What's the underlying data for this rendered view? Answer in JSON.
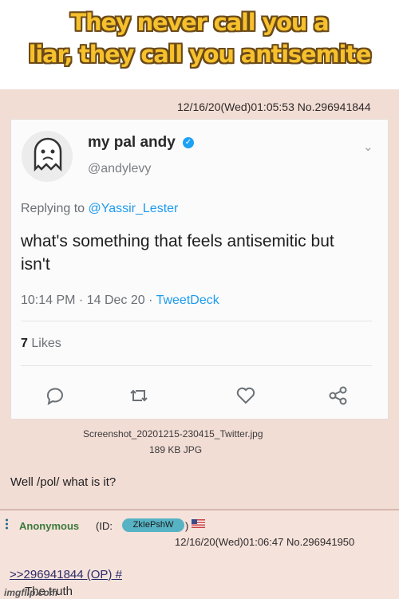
{
  "caption": {
    "line1": "They never call you a",
    "line2": "liar, they call you antisemite"
  },
  "post1": {
    "meta": "12/16/20(Wed)01:05:53 No.296941844",
    "file_name": "Screenshot_20201215-230415_Twitter.jpg",
    "file_size": "189 KB JPG",
    "comment": "Well /pol/ what is it?"
  },
  "tweet": {
    "name": "my pal andy",
    "verified_icon": "✓",
    "handle": "@andylevy",
    "replying_prefix": "Replying to",
    "replying_to": "@Yassir_Lester",
    "text": "what's something that feels antisemitic but isn't",
    "time": "10:14 PM · 14 Dec 20 ·",
    "source": "TweetDeck",
    "likes_count": "7",
    "likes_label": "Likes",
    "icons": [
      "reply-icon",
      "retweet-icon",
      "like-icon",
      "share-icon"
    ]
  },
  "post2": {
    "name": "Anonymous",
    "id_prefix": "(ID:",
    "id_value": "ZkIePshW",
    "id_suffix": ")",
    "meta": "12/16/20(Wed)01:06:47 No.296941950",
    "quote": ">>296941844 (OP) #",
    "text": "The truth"
  },
  "watermark": "imgflip.com",
  "colors": {
    "caption": "#f6c12c",
    "post_bg": "#f2ddd5",
    "name_green": "#3b7a3b",
    "link": "#1d9bf0"
  }
}
